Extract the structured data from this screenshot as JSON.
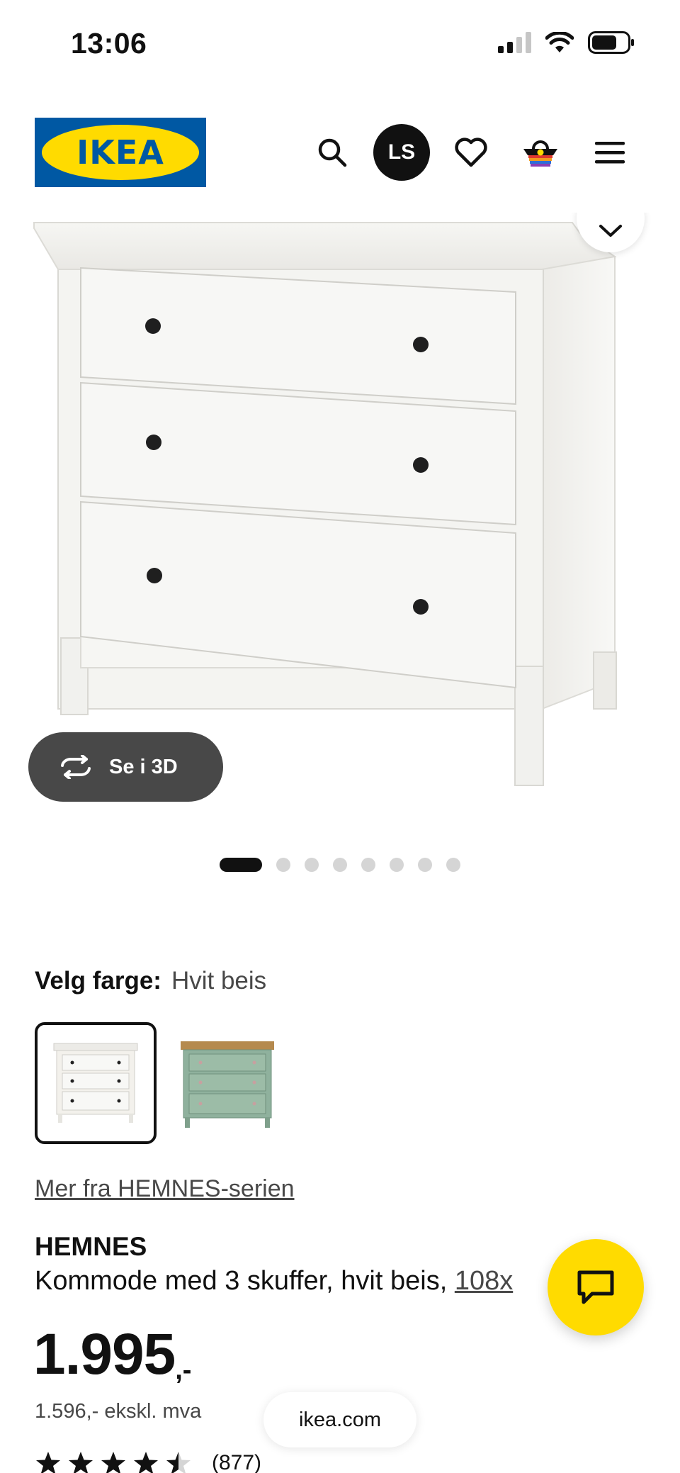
{
  "status_bar": {
    "time": "13:06"
  },
  "header": {
    "logo_text": "IKEA",
    "avatar_initials": "LS",
    "icons": [
      "search-icon",
      "heart-icon",
      "basket-icon",
      "menu-icon"
    ]
  },
  "gallery": {
    "view_3d_label": "Se i 3D",
    "dot_count": 8,
    "active_dot": 0
  },
  "color_selector": {
    "label": "Velg farge:",
    "selected_value": "Hvit beis",
    "options": [
      {
        "name": "Hvit beis",
        "color": "#f3f1ec",
        "selected": true
      },
      {
        "name": "Grønn",
        "color": "#9cbca7",
        "selected": false
      }
    ]
  },
  "series_link": "Mer fra HEMNES-serien",
  "product": {
    "name": "HEMNES",
    "description": "Kommode med 3 skuffer, hvit beis, ",
    "measure_link": "108x"
  },
  "price": {
    "main": "1.995",
    "suffix": ",-",
    "ex_vat": "1.596,- ekskl. mva"
  },
  "rating": {
    "stars": 4.5,
    "count": "(877)"
  },
  "browser": {
    "url": "ikea.com"
  },
  "colors": {
    "brand_blue": "#0058a3",
    "brand_yellow": "#ffdb00",
    "dark_button": "#484848"
  }
}
